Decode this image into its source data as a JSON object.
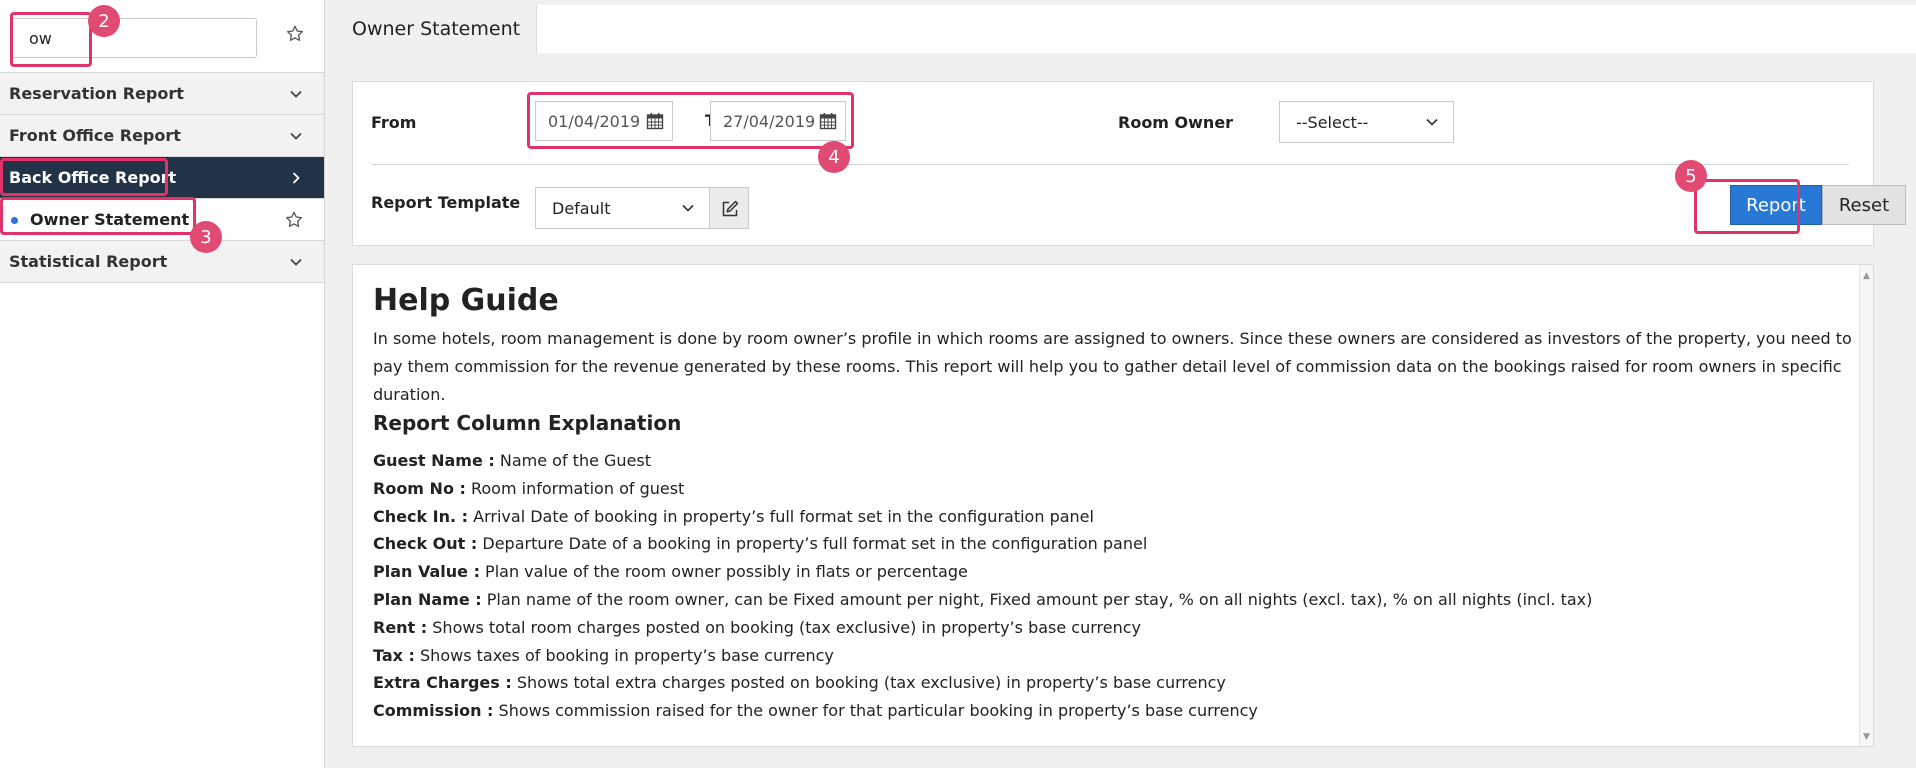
{
  "sidebar": {
    "search": {
      "value": "ow",
      "placeholder": ""
    },
    "items": [
      {
        "label": "Reservation Report"
      },
      {
        "label": "Front Office Report"
      },
      {
        "label": "Back Office Report"
      },
      {
        "label": "Statistical Report"
      }
    ],
    "sub_item": {
      "label": "Owner Statement"
    }
  },
  "header": {
    "title": "Owner Statement"
  },
  "filters": {
    "from_label": "From",
    "from_value": "01/04/2019",
    "to_label": "To",
    "to_value": "27/04/2019",
    "room_owner_label": "Room Owner",
    "room_owner_value": "--Select--",
    "template_label": "Report Template",
    "template_value": "Default",
    "report_button": "Report",
    "reset_button": "Reset"
  },
  "help": {
    "title": "Help Guide",
    "intro": "In some hotels, room management is done by room owner’s profile in which rooms are assigned to owners. Since these owners are considered as investors of the property, you need to pay them commission for the revenue generated by these rooms. This report will help you to gather detail level of commission data on the bookings raised for room owners in specific duration.",
    "columns_title": "Report Column Explanation",
    "columns": [
      {
        "term": "Guest Name :",
        "desc": " Name of the Guest"
      },
      {
        "term": "Room No :",
        "desc": " Room information of guest"
      },
      {
        "term": "Check In. :",
        "desc": " Arrival Date of booking in property’s full format set in the configuration panel"
      },
      {
        "term": "Check Out :",
        "desc": " Departure Date of a booking in property’s full format set in the configuration panel"
      },
      {
        "term": "Plan Value :",
        "desc": " Plan value of the room owner possibly in flats or percentage"
      },
      {
        "term": "Plan Name :",
        "desc": " Plan name of the room owner, can be Fixed amount per night, Fixed amount per stay, % on all nights (excl. tax), % on all nights (incl. tax)"
      },
      {
        "term": "Rent :",
        "desc": " Shows total room charges posted on booking (tax exclusive) in property’s base currency"
      },
      {
        "term": "Tax :",
        "desc": " Shows taxes of booking in property’s base currency"
      },
      {
        "term": "Extra Charges :",
        "desc": " Shows total extra charges posted on booking (tax exclusive) in property’s base currency"
      },
      {
        "term": "Commission :",
        "desc": " Shows commission raised for the owner for that particular booking in property’s base currency"
      }
    ]
  },
  "annotations": {
    "badge2": "2",
    "badge3": "3",
    "badge4": "4",
    "badge5": "5"
  },
  "colors": {
    "accent": "#2878d6",
    "sidebar_active": "#223347",
    "highlight": "#e0336b",
    "badge": "#e14a72"
  }
}
